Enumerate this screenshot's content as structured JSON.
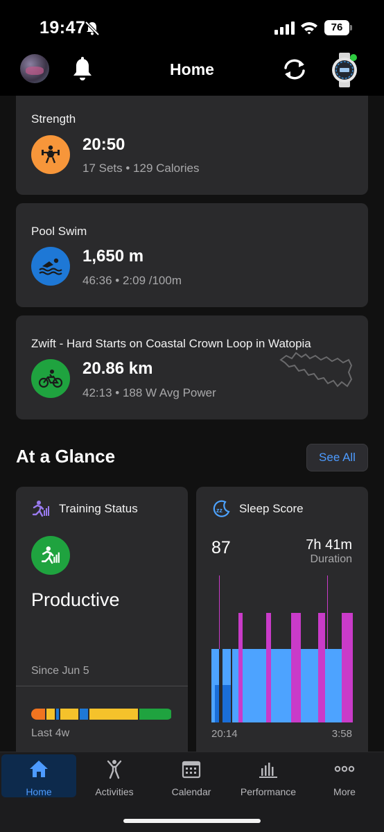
{
  "status_bar": {
    "time": "19:47",
    "battery": "76"
  },
  "header": {
    "title": "Home"
  },
  "activities": [
    {
      "name": "Strength",
      "main": "20:50",
      "sub": "17 Sets • 129 Calories",
      "icon": "weightlifter-icon",
      "color": "#f7963a"
    },
    {
      "name": "Pool Swim",
      "main": "1,650 m",
      "sub": "46:36 • 2:09 /100m",
      "icon": "swimmer-icon",
      "color": "#1e78d6"
    },
    {
      "name": "Zwift - Hard Starts on Coastal Crown Loop in Watopia",
      "main": "20.86 km",
      "sub": "42:13 • 188 W Avg Power",
      "icon": "cyclist-icon",
      "color": "#1fa33f"
    }
  ],
  "glance": {
    "title": "At a Glance",
    "see_all": "See All",
    "training_status": {
      "title": "Training Status",
      "status": "Productive",
      "since": "Since Jun 5",
      "period": "Last 4w",
      "history_colors": [
        "#f07420",
        "#f5c22b",
        "#1e78d6",
        "#f5c22b",
        "#1e78d6",
        "#f5c22b",
        "#1fa33f"
      ]
    },
    "sleep": {
      "title": "Sleep Score",
      "score": "87",
      "duration": "7h 41m",
      "duration_label": "Duration",
      "start": "20:14",
      "end": "3:58",
      "colors": {
        "light": "#4da3ff",
        "deep": "#1a6ed8",
        "rem": "#c93bc9"
      }
    }
  },
  "tabs": [
    {
      "label": "Home",
      "icon": "home-icon",
      "active": true
    },
    {
      "label": "Activities",
      "icon": "activities-icon",
      "active": false
    },
    {
      "label": "Calendar",
      "icon": "calendar-icon",
      "active": false
    },
    {
      "label": "Performance",
      "icon": "performance-icon",
      "active": false
    },
    {
      "label": "More",
      "icon": "more-icon",
      "active": false
    }
  ]
}
